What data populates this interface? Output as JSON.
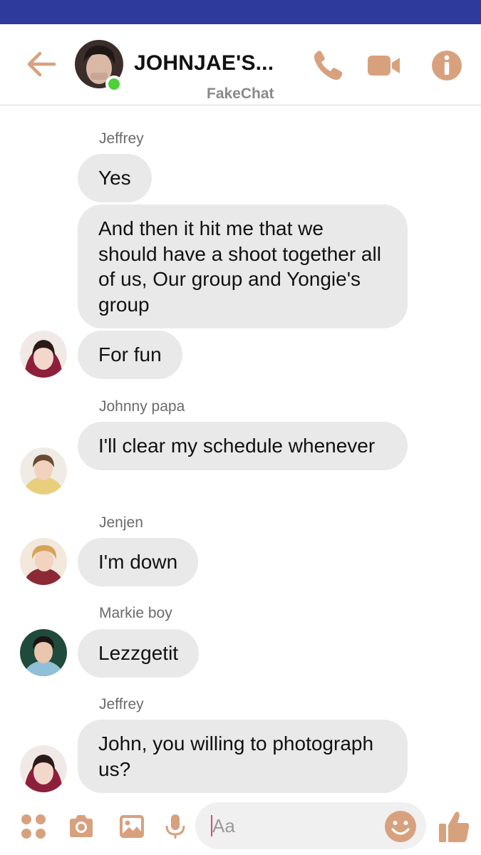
{
  "colors": {
    "status_bar": "#2f3b9c",
    "accent": "#d8a17e",
    "online": "#4cd137",
    "bubble": "#e9e9e9"
  },
  "header": {
    "title": "JOHNJAE'S...",
    "subtitle": "FakeChat",
    "icons": [
      "back-arrow-icon",
      "phone-icon",
      "video-camera-icon",
      "info-icon"
    ]
  },
  "messages": [
    {
      "sender": "Jeffrey",
      "texts": [
        "Yes",
        "And then it hit me that we should have a shoot together all of us, Our group and Yongie's group",
        "For fun"
      ]
    },
    {
      "sender": "Johnny papa",
      "texts": [
        "I'll clear my schedule whenever"
      ]
    },
    {
      "sender": "Jenjen",
      "texts": [
        "I'm down"
      ]
    },
    {
      "sender": "Markie boy",
      "texts": [
        "Lezzgetit"
      ]
    },
    {
      "sender": "Jeffrey",
      "texts": [
        "John, you willing to photograph us?"
      ]
    }
  ],
  "composer": {
    "placeholder": "Aa",
    "icons": [
      "menu-dots-icon",
      "camera-icon",
      "image-icon",
      "microphone-icon",
      "emoji-icon",
      "thumbs-up-icon"
    ]
  }
}
